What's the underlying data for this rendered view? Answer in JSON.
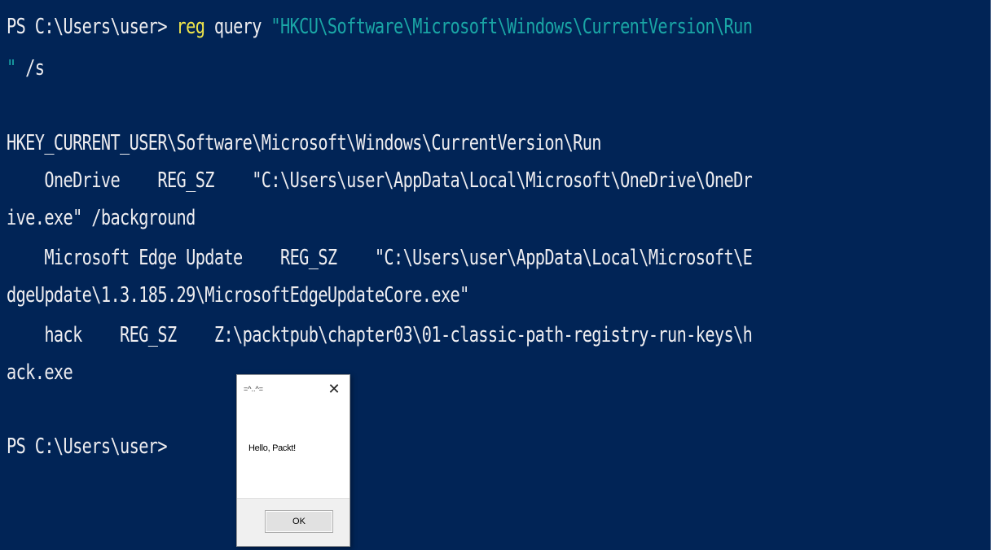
{
  "terminal": {
    "background_color": "#012456",
    "text_color": "#eeedf0",
    "command_color": "#f0e64b",
    "string_color": "#1aa6a6",
    "prompt_1": "PS C:\\Users\\user> ",
    "command": "reg",
    "command_args": " query ",
    "command_string_part1": "\"HKCU\\Software\\Microsoft\\Windows\\CurrentVersion\\Run",
    "command_string_part2": "\"",
    "command_flag": " /s",
    "output": [
      "HKEY_CURRENT_USER\\Software\\Microsoft\\Windows\\CurrentVersion\\Run",
      "    OneDrive    REG_SZ    \"C:\\Users\\user\\AppData\\Local\\Microsoft\\OneDrive\\OneDr",
      "ive.exe\" /background",
      "    Microsoft Edge Update    REG_SZ    \"C:\\Users\\user\\AppData\\Local\\Microsoft\\E",
      "dgeUpdate\\1.3.185.29\\MicrosoftEdgeUpdateCore.exe\"",
      "    hack    REG_SZ    Z:\\packtpub\\chapter03\\01-classic-path-registry-run-keys\\h",
      "ack.exe"
    ],
    "prompt_2": "PS C:\\Users\\user>"
  },
  "dialog": {
    "title": "=^..^=",
    "close_glyph": "✕",
    "message": "Hello, Packt!",
    "ok_label": "OK"
  }
}
